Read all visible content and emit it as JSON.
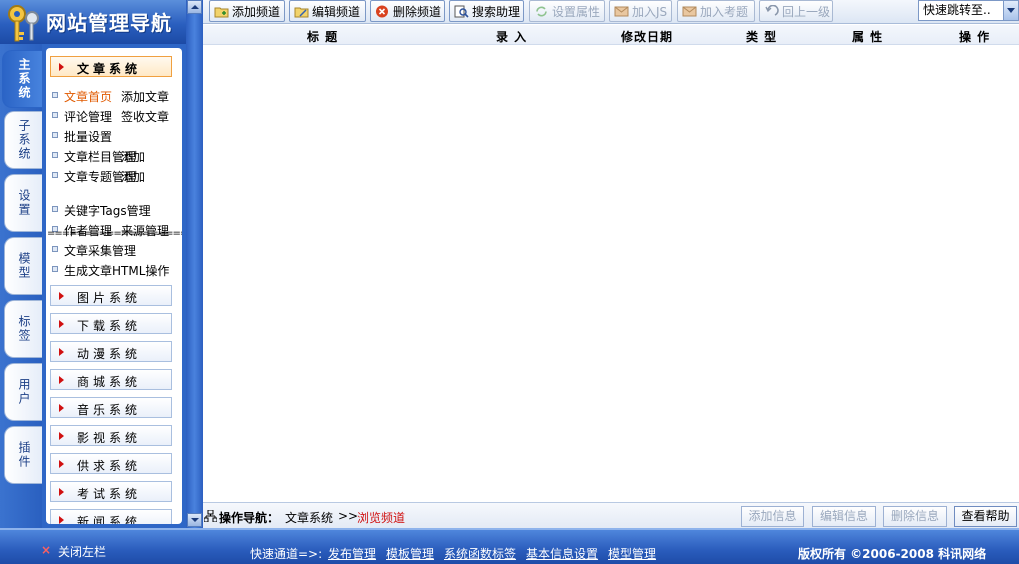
{
  "app": {
    "title": "网站管理导航"
  },
  "vertical_tabs": [
    {
      "label": "主系统",
      "active": true
    },
    {
      "label": "子系统"
    },
    {
      "label": "设置"
    },
    {
      "label": "模型"
    },
    {
      "label": "标签"
    },
    {
      "label": "用户"
    },
    {
      "label": "插件"
    }
  ],
  "sidebar": {
    "active_system": "文章系统",
    "menu": [
      {
        "a": "文章首页",
        "b": "添加文章",
        "highlight": true
      },
      {
        "a": "评论管理",
        "b": "签收文章"
      },
      {
        "a": "批量设置",
        "b": ""
      },
      {
        "a": "文章栏目管理",
        "b": "添加"
      },
      {
        "a": "文章专题管理",
        "b": "添加"
      },
      {
        "a": "关键字Tags管理",
        "b": ""
      },
      {
        "a": "作者管理",
        "b": "来源管理"
      },
      {
        "a": "文章采集管理",
        "b": ""
      },
      {
        "a": "生成文章HTML操作",
        "b": ""
      }
    ],
    "separator": "====================",
    "systems": [
      "图片系统",
      "下载系统",
      "动漫系统",
      "商城系统",
      "音乐系统",
      "影视系统",
      "供求系统",
      "考试系统",
      "新闻系统"
    ]
  },
  "toolbar": {
    "buttons": [
      {
        "label": "添加频道",
        "icon": "folder-add-icon",
        "enabled": true
      },
      {
        "label": "编辑频道",
        "icon": "folder-edit-icon",
        "enabled": true
      },
      {
        "label": "删除频道",
        "icon": "delete-icon",
        "enabled": true
      },
      {
        "label": "搜索助理",
        "icon": "search-icon",
        "enabled": true
      },
      {
        "label": "设置属性",
        "icon": "refresh-icon",
        "enabled": false
      },
      {
        "label": "加入JS",
        "icon": "mail-icon",
        "enabled": false
      },
      {
        "label": "加入考题",
        "icon": "mail-icon",
        "enabled": false
      },
      {
        "label": "回上一级",
        "icon": "back-icon",
        "enabled": false
      }
    ],
    "quick_jump": "快速跳转至.."
  },
  "table": {
    "columns": [
      "标 题",
      "录 入",
      "修改日期",
      "类 型",
      "属 性",
      "操 作"
    ]
  },
  "operation_nav": {
    "label": "操作导航：",
    "system": "文章系统",
    "separator": ">>",
    "current": "浏览频道",
    "buttons": [
      {
        "label": "添加信息",
        "enabled": false
      },
      {
        "label": "编辑信息",
        "enabled": false
      },
      {
        "label": "删除信息",
        "enabled": false
      },
      {
        "label": "查看帮助",
        "enabled": true
      }
    ]
  },
  "footer": {
    "close_left": "关闭左栏",
    "quick_label": "快速通道=>:",
    "links": [
      "发布管理",
      "模板管理",
      "系统函数标签",
      "基本信息设置",
      "模型管理"
    ],
    "copyright": "版权所有 ©2006-2008 科讯网络"
  },
  "colors": {
    "frame_blue": "#2e66c6",
    "active_system_border": "#f0a040",
    "highlight_text": "#e05a00",
    "current_nav": "#d01010"
  }
}
